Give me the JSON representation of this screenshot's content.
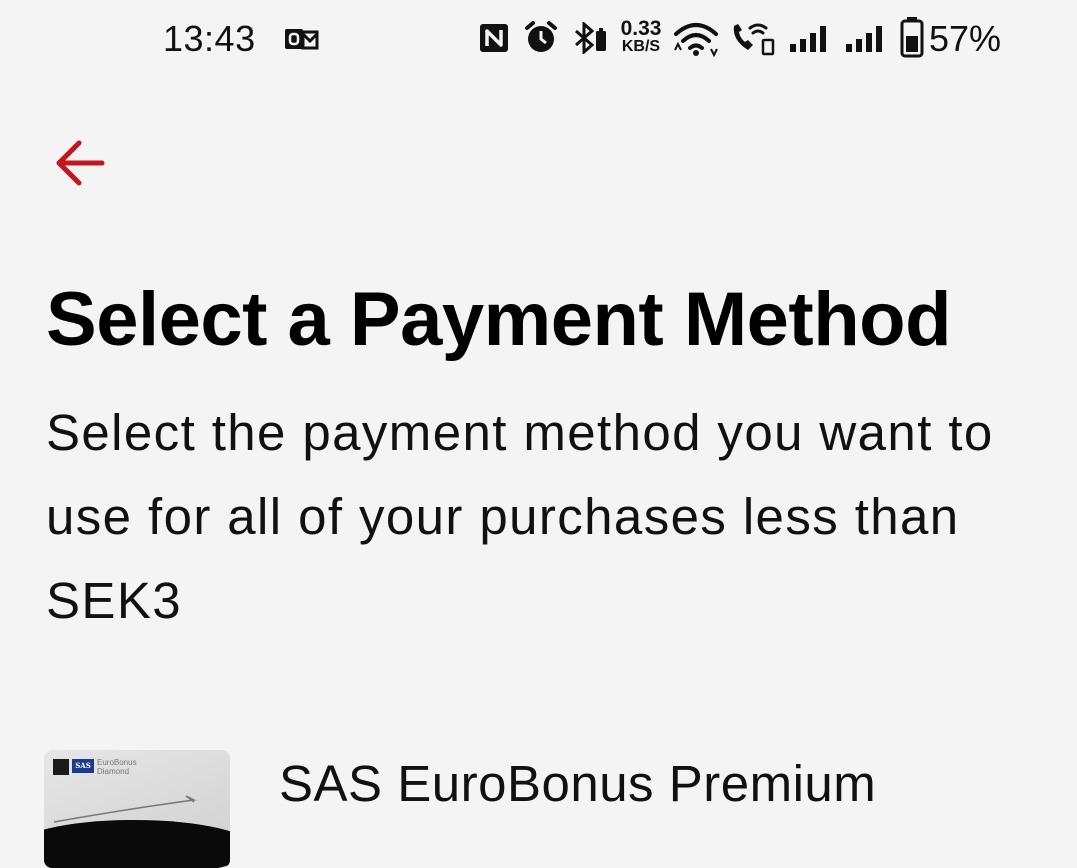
{
  "status_bar": {
    "time": "13:43",
    "network_speed_value": "0.33",
    "network_speed_unit": "KB/S",
    "battery_percent": "57%",
    "icons": [
      "outlook-notification-icon",
      "nfc-icon",
      "alarm-icon",
      "bluetooth-icon",
      "wifi-icon",
      "wifi-calling-icon",
      "signal-icon",
      "signal-icon",
      "battery-icon"
    ]
  },
  "header": {
    "back_label": "Back",
    "back_icon": "arrow-left-icon",
    "back_color": "#c4161c"
  },
  "main": {
    "title": "Select a Payment Method",
    "description": "Select the payment method you want to use for all of your purchases less than SEK3"
  },
  "payment_methods": [
    {
      "label": "SAS EuroBonus Premium",
      "card_brand": "SAS",
      "card_line1": "EuroBonus",
      "card_line2": "Diamond"
    }
  ],
  "colors": {
    "background": "#f4f4f4",
    "accent": "#c4161c",
    "text": "#000000"
  }
}
